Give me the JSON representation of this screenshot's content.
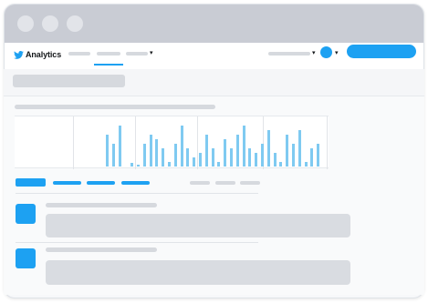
{
  "window": {
    "traffic_lights": [
      "window-dot",
      "window-dot",
      "window-dot"
    ]
  },
  "navbar": {
    "brand": "Analytics",
    "brand_icon": "twitter-bird-icon",
    "accent_color": "#1da1f2",
    "nav_tabs": [
      {
        "id": "nav-tab-1",
        "active": false
      },
      {
        "id": "nav-tab-2",
        "active": true
      },
      {
        "id": "nav-tab-3",
        "has_dropdown": true
      }
    ],
    "right": {
      "account_dropdown": true,
      "avatar_dropdown": true,
      "primary_button": true
    }
  },
  "chart_data": {
    "type": "bar",
    "title": "",
    "xlabel": "",
    "ylabel": "",
    "series": [
      {
        "values": [
          0,
          0,
          0,
          0,
          0,
          0,
          0,
          0,
          0,
          0,
          0,
          0,
          0,
          0,
          0,
          0,
          0,
          0,
          0,
          0,
          0,
          0,
          0,
          0,
          0,
          0,
          0,
          0,
          0,
          0,
          0,
          0,
          0,
          0,
          0,
          0,
          0,
          0,
          0,
          0,
          0,
          0,
          0,
          0,
          0,
          0,
          0,
          0,
          0,
          0,
          0,
          0,
          0,
          0,
          0,
          0,
          0,
          0,
          0,
          0,
          0,
          0,
          0,
          0,
          0,
          0,
          0,
          0,
          0,
          0,
          0,
          0,
          0,
          0,
          0,
          0,
          0,
          0,
          0,
          0,
          0,
          0,
          0,
          0,
          0,
          0,
          0,
          0,
          0,
          0
        ]
      }
    ],
    "bars": [
      35,
      25,
      45,
      0,
      4,
      2,
      25,
      35,
      30,
      20,
      5,
      25,
      45,
      20,
      10,
      15,
      35,
      20,
      5,
      30,
      20,
      35,
      45,
      20,
      15,
      25,
      40,
      15,
      5,
      35,
      25,
      40,
      5,
      20,
      25
    ]
  },
  "tabs": {
    "active_index": 0,
    "count": 4
  },
  "list": {
    "rows": [
      {
        "icon": "tweet-thumbnail-icon"
      },
      {
        "icon": "tweet-thumbnail-icon"
      }
    ]
  }
}
